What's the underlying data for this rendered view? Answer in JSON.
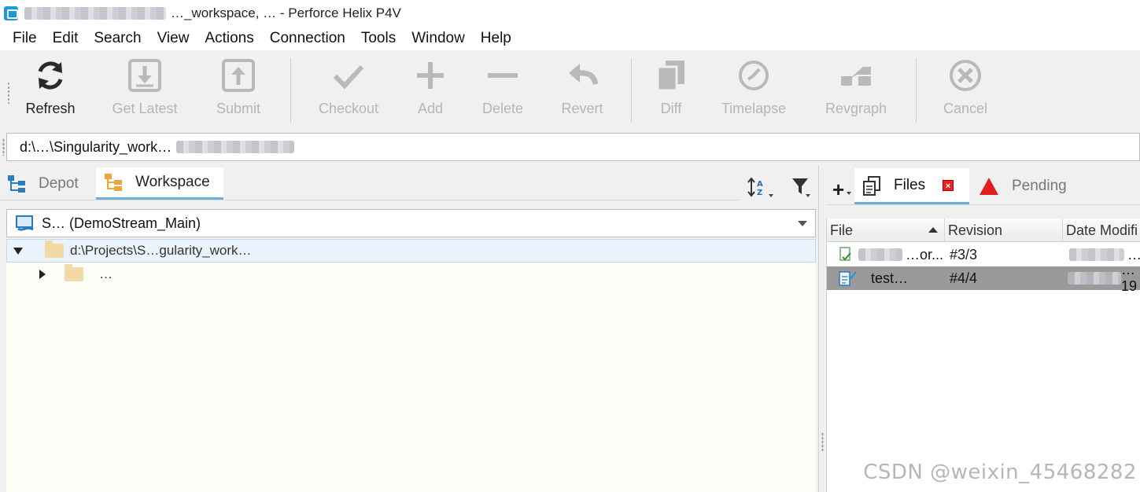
{
  "window": {
    "title": "…_workspace, … - Perforce Helix P4V"
  },
  "menu": [
    "File",
    "Edit",
    "Search",
    "View",
    "Actions",
    "Connection",
    "Tools",
    "Window",
    "Help"
  ],
  "toolbar": {
    "refresh": "Refresh",
    "get_latest": "Get Latest",
    "submit": "Submit",
    "checkout": "Checkout",
    "add": "Add",
    "delete": "Delete",
    "revert": "Revert",
    "diff": "Diff",
    "timelapse": "Timelapse",
    "revgraph": "Revgraph",
    "cancel": "Cancel"
  },
  "path_bar": {
    "value": "d:\\…\\Singularity_work…"
  },
  "left_tabs": {
    "depot": "Depot",
    "workspace": "Workspace"
  },
  "workspace_select": {
    "value": "S… (DemoStream_Main)"
  },
  "tree": {
    "root": "d:\\Projects\\S…gularity_work…",
    "child": "…"
  },
  "right_tabs": {
    "files": "Files",
    "pending": "Pending"
  },
  "files_table": {
    "headers": [
      "File",
      "Revision",
      "Date Modifi"
    ],
    "rows": [
      {
        "file": "…or...",
        "revision": "#3/3",
        "date": "…:1"
      },
      {
        "file": "test…",
        "revision": "#4/4",
        "date": "…19"
      }
    ]
  },
  "watermark": "CSDN @weixin_45468282",
  "colors": {
    "accent": "#6baedc",
    "app_icon": "#1a9ad6",
    "disabled": "#b5b5b5",
    "selected_row": "#9a9a9a"
  }
}
